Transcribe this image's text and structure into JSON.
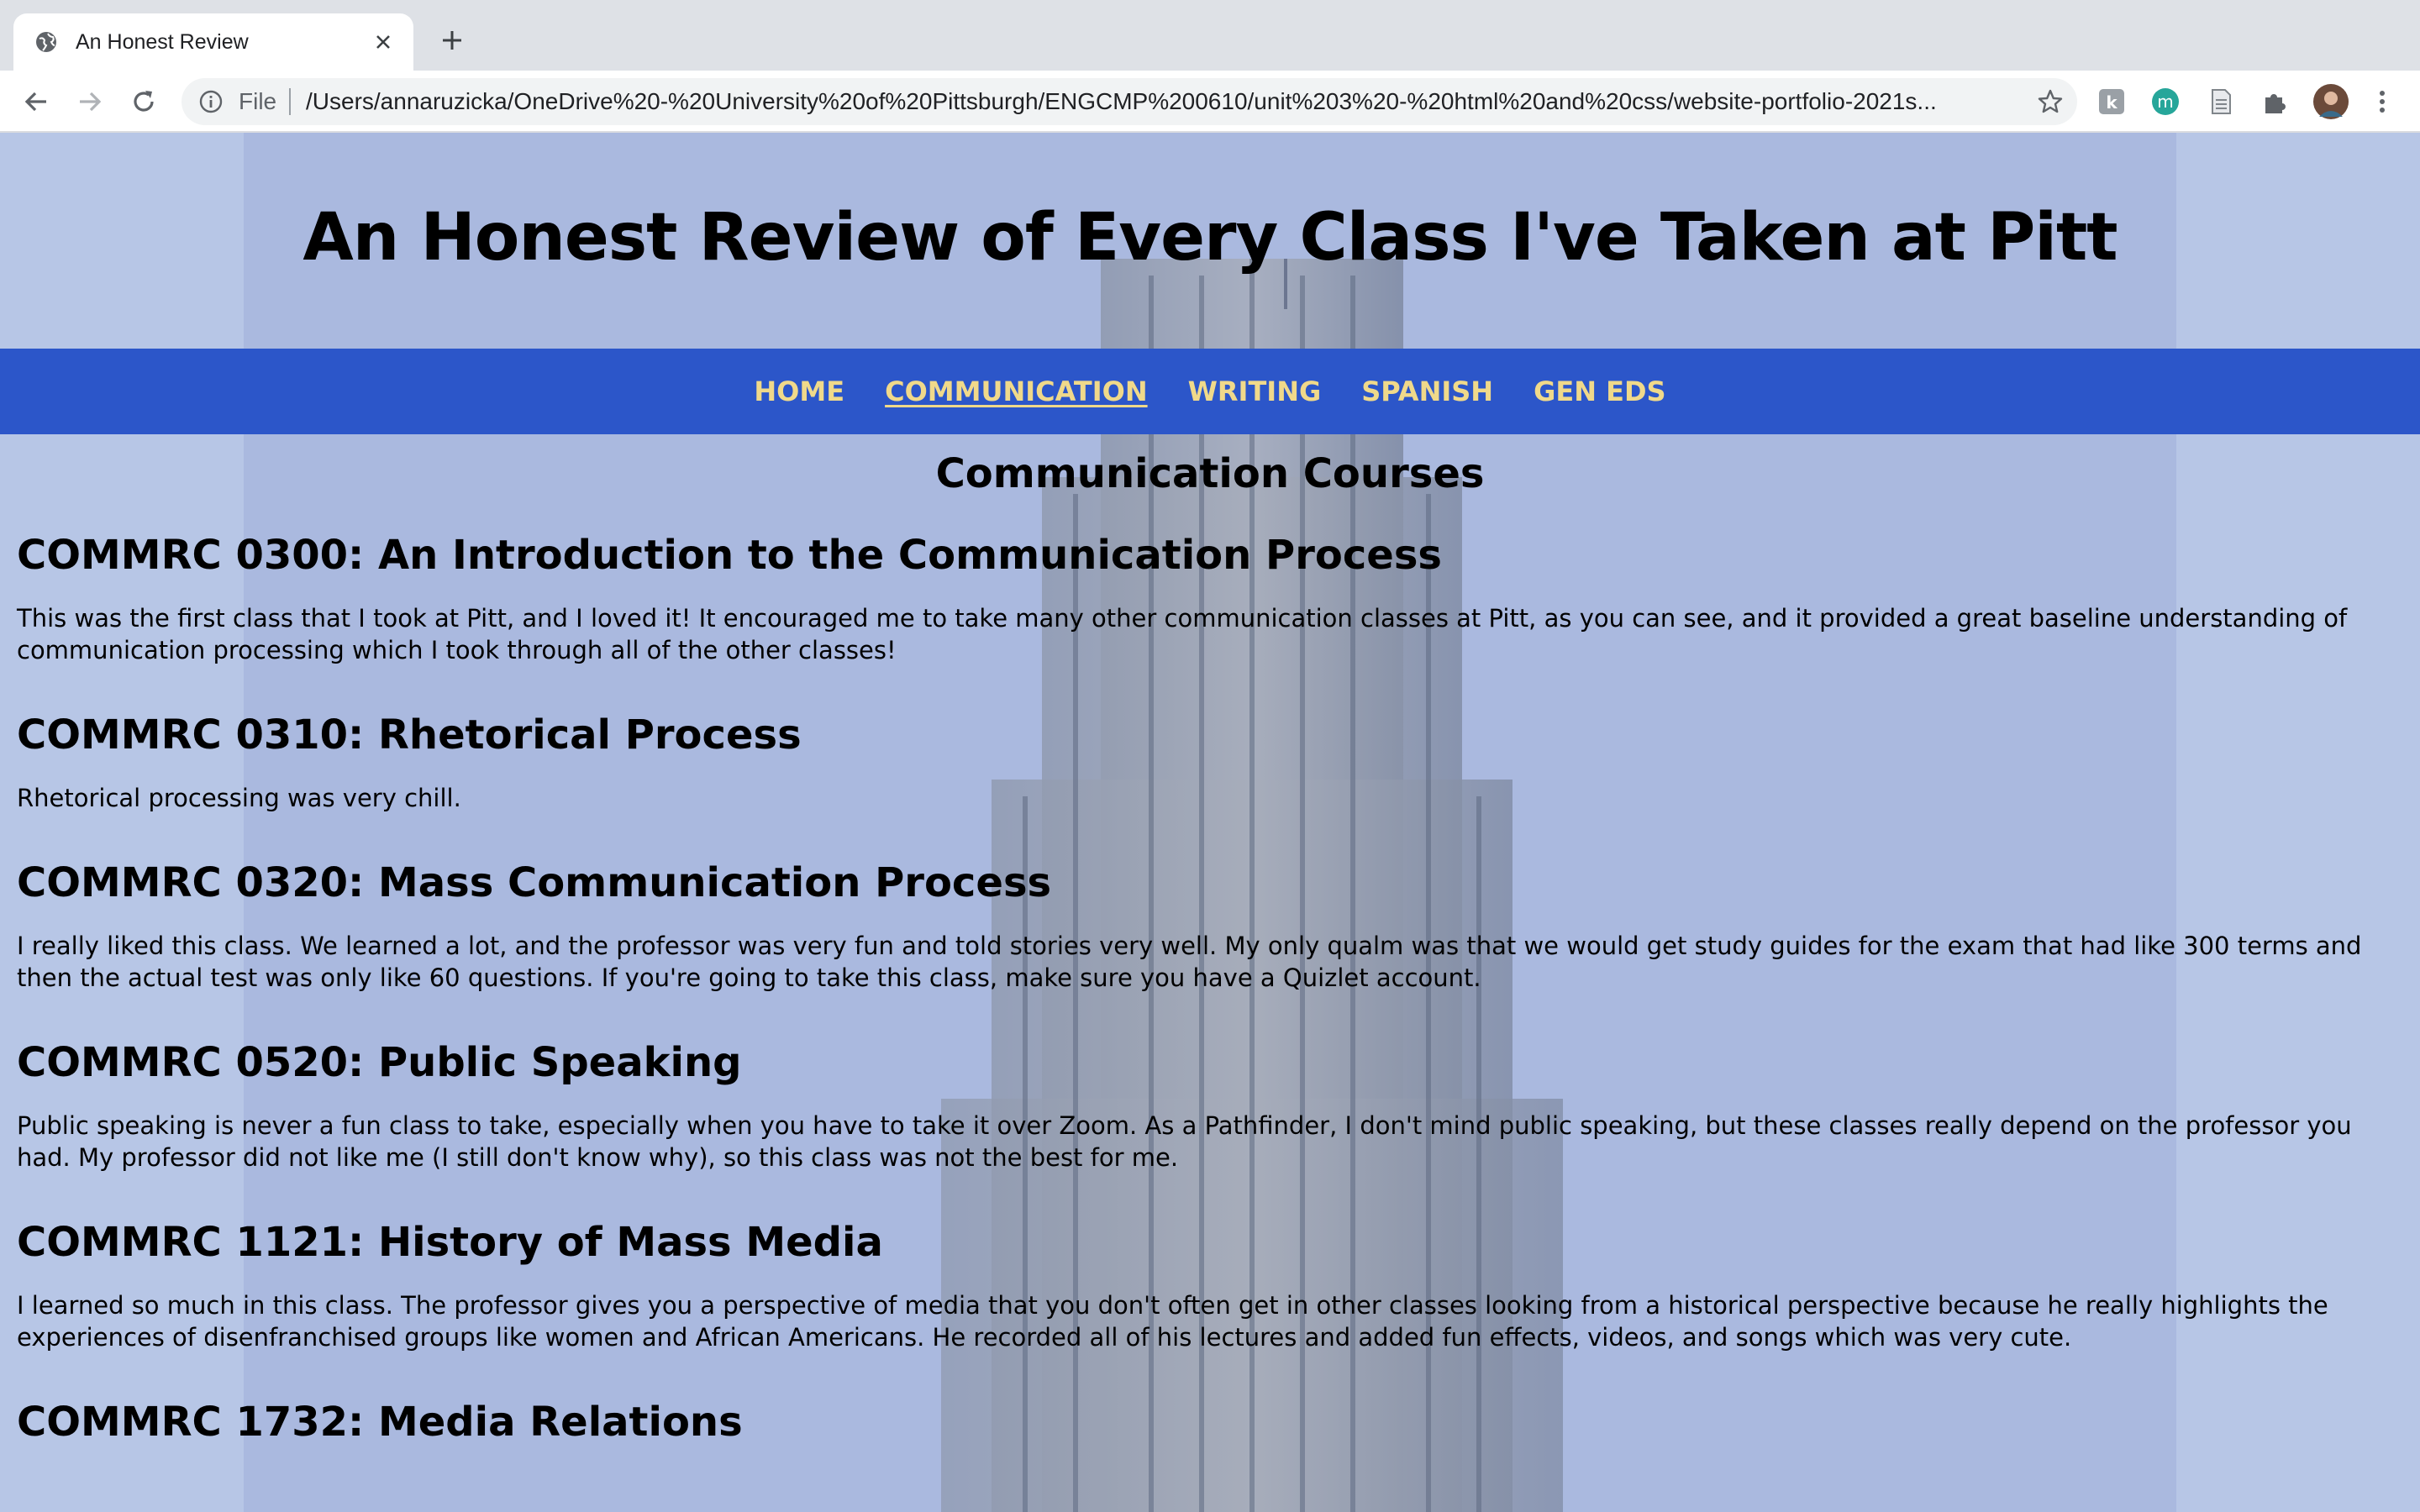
{
  "browser": {
    "tab": {
      "title": "An Honest Review",
      "favicon": "globe-icon",
      "close": "close-icon"
    },
    "new_tab": "plus-icon",
    "nav": {
      "back": "back-arrow-icon",
      "forward": "forward-arrow-icon",
      "reload": "reload-icon"
    },
    "address": {
      "scheme": "File",
      "url": "/Users/annaruzicka/OneDrive%20-%20University%20of%20Pittsburgh/ENGCMP%200610/unit%203%20-%20html%20and%20css/website-portfolio-2021s..."
    },
    "extensions": [
      "k-extension-icon",
      "m-extension-icon",
      "document-extension-icon",
      "puzzle-icon",
      "profile-avatar",
      "menu-dots-icon"
    ]
  },
  "site": {
    "title": "An Honest Review of Every Class I've Taken at Pitt",
    "nav": [
      {
        "label": "HOME",
        "active": false
      },
      {
        "label": "COMMUNICATION",
        "active": true
      },
      {
        "label": "WRITING",
        "active": false
      },
      {
        "label": "SPANISH",
        "active": false
      },
      {
        "label": "GEN EDS",
        "active": false
      }
    ],
    "colors": {
      "nav_bg": "#2c56c9",
      "nav_text": "#f0d98a",
      "page_bg": "#aab9df"
    }
  },
  "page": {
    "heading": "Communication Courses",
    "courses": [
      {
        "title": "COMMRC 0300: An Introduction to the Communication Process",
        "description": "This was the first class that I took at Pitt, and I loved it! It encouraged me to take many other communication classes at Pitt, as you can see, and it provided a great baseline understanding of communication processing which I took through all of the other classes!"
      },
      {
        "title": "COMMRC 0310: Rhetorical Process",
        "description": "Rhetorical processing was very chill."
      },
      {
        "title": "COMMRC 0320: Mass Communication Process",
        "description": "I really liked this class. We learned a lot, and the professor was very fun and told stories very well. My only qualm was that we would get study guides for the exam that had like 300 terms and then the actual test was only like 60 questions. If you're going to take this class, make sure you have a Quizlet account."
      },
      {
        "title": "COMMRC 0520: Public Speaking",
        "description": "Public speaking is never a fun class to take, especially when you have to take it over Zoom. As a Pathfinder, I don't mind public speaking, but these classes really depend on the professor you had. My professor did not like me (I still don't know why), so this class was not the best for me."
      },
      {
        "title": "COMMRC 1121: History of Mass Media",
        "description": "I learned so much in this class. The professor gives you a perspective of media that you don't often get in other classes looking from a historical perspective because he really highlights the experiences of disenfranchised groups like women and African Americans. He recorded all of his lectures and added fun effects, videos, and songs which was very cute."
      },
      {
        "title": "COMMRC 1732: Media Relations",
        "description": ""
      }
    ]
  }
}
